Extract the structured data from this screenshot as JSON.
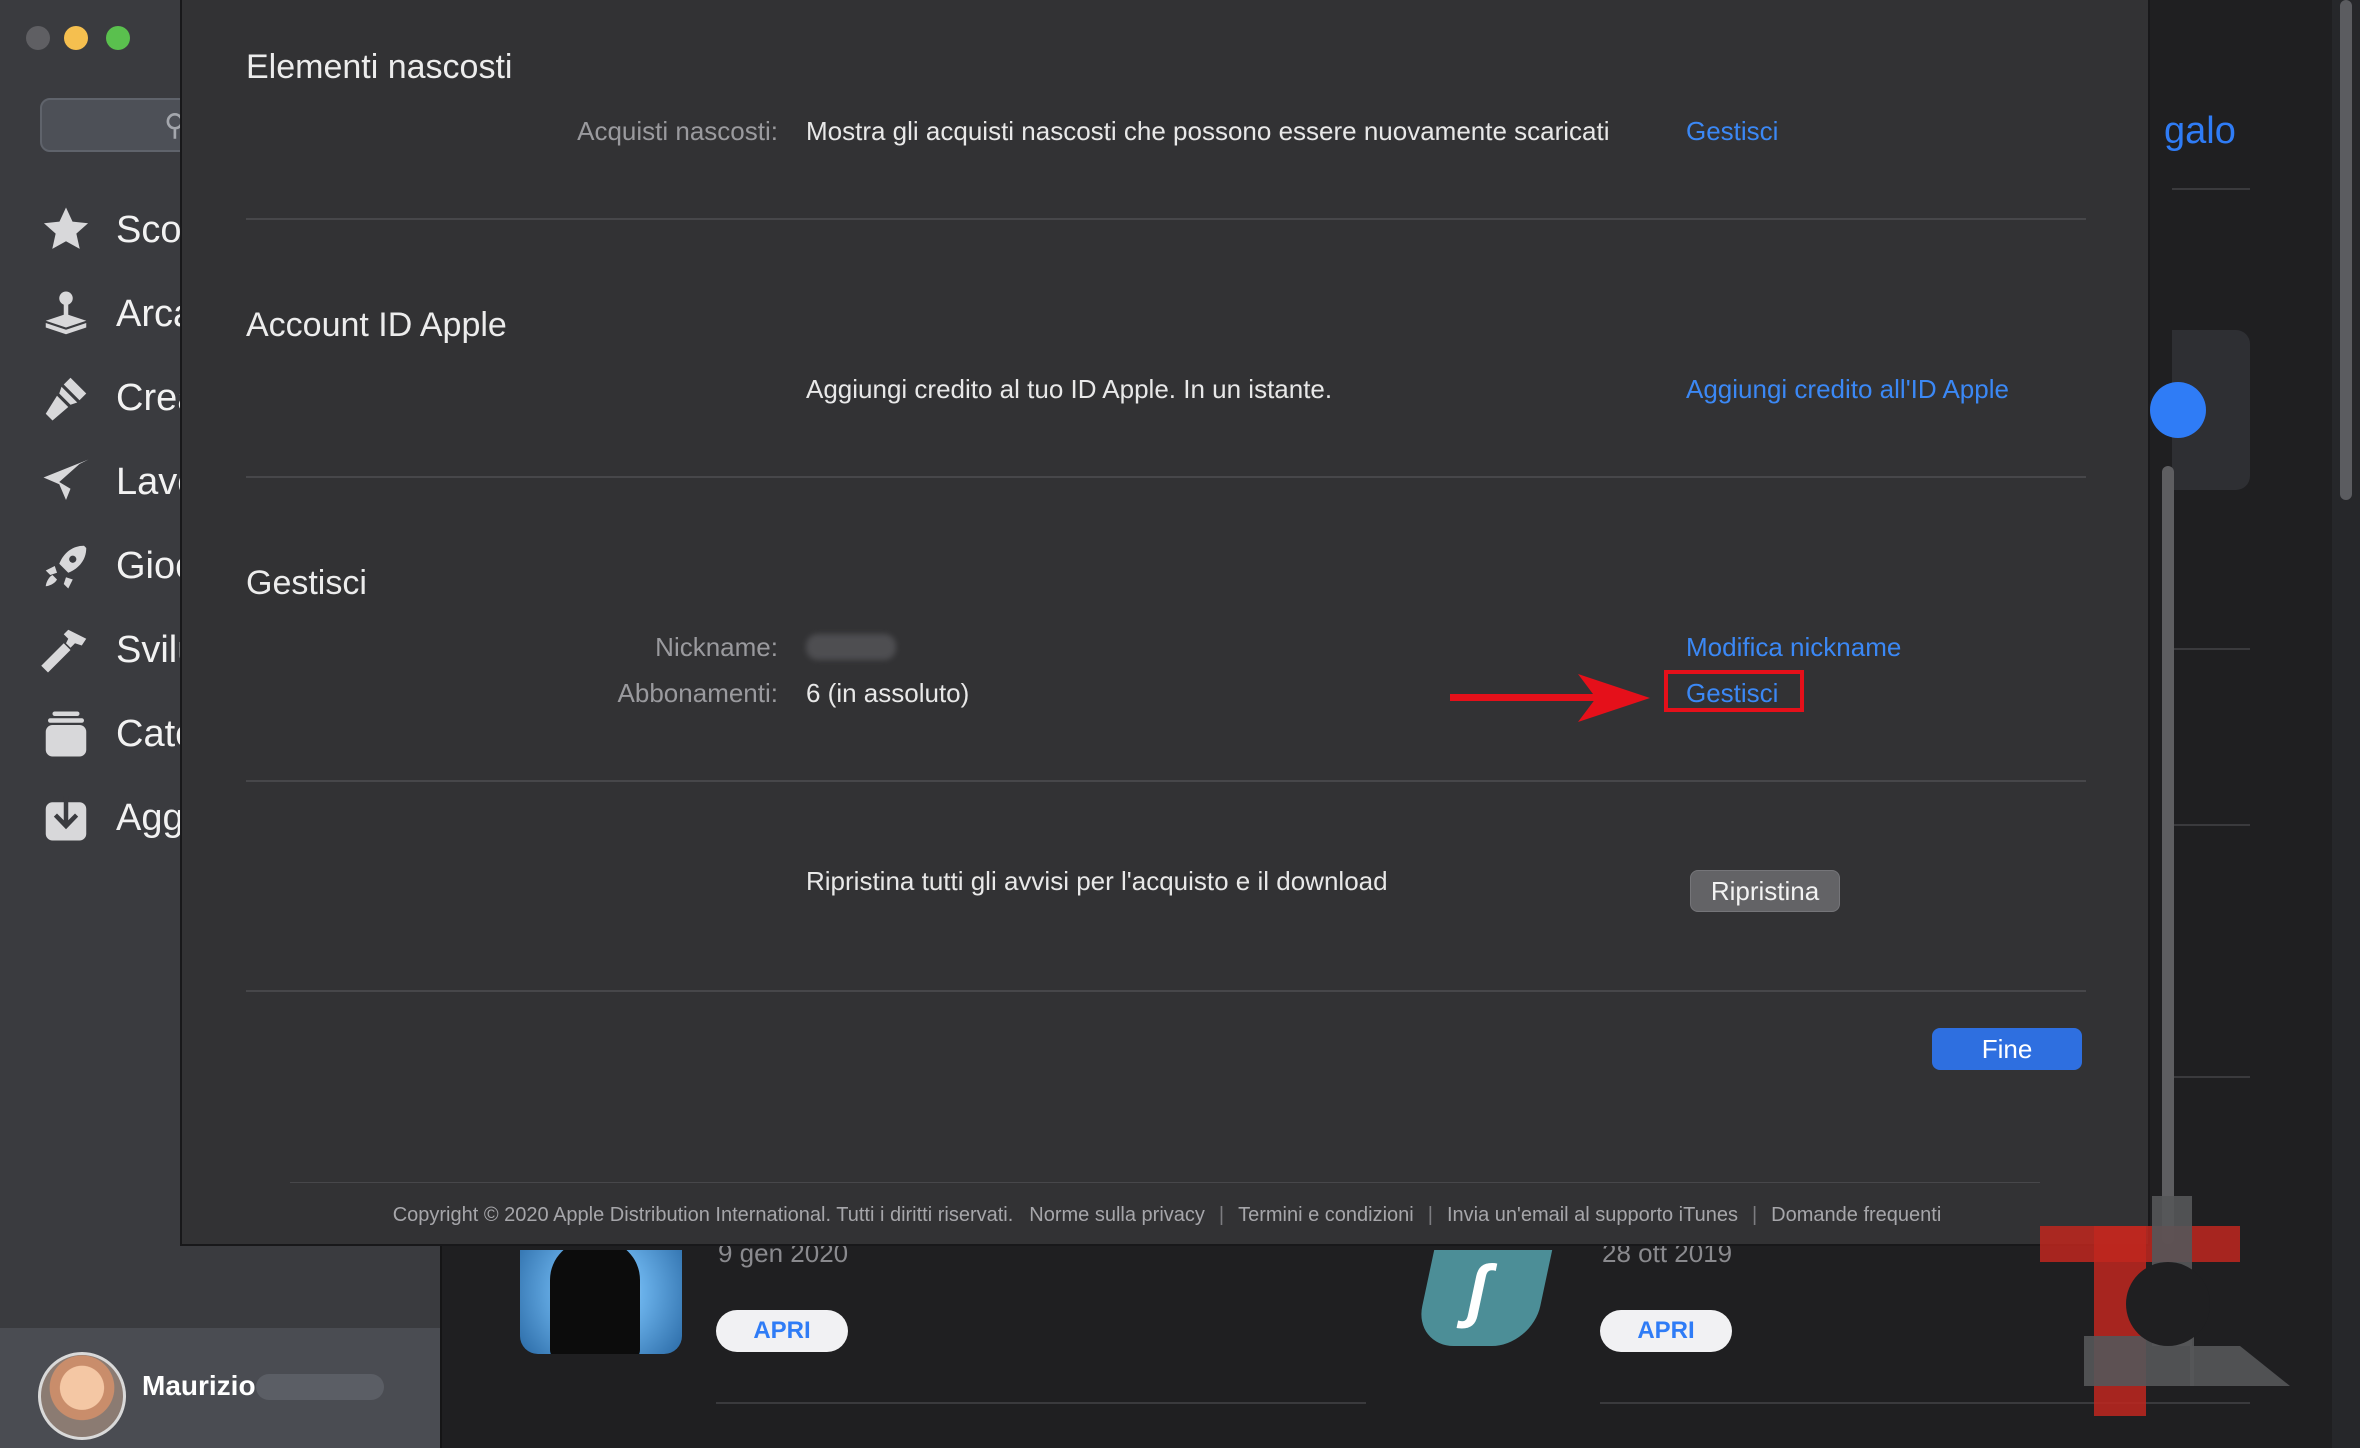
{
  "sidebar": {
    "items": [
      {
        "label": "Sco",
        "icon": "star-icon"
      },
      {
        "label": "Arca",
        "icon": "joystick-icon"
      },
      {
        "label": "Crea",
        "icon": "brush-icon"
      },
      {
        "label": "Lavo",
        "icon": "paper-plane-icon"
      },
      {
        "label": "Gioc",
        "icon": "rocket-icon"
      },
      {
        "label": "Svilu",
        "icon": "hammer-icon"
      },
      {
        "label": "Cate",
        "icon": "layers-icon"
      },
      {
        "label": "Agg",
        "icon": "download-icon"
      }
    ],
    "user_name": "Maurizio"
  },
  "background": {
    "header_link": "galo",
    "apps": [
      {
        "date": "9 gen 2020",
        "button": "APRI"
      },
      {
        "date": "28 ott 2019",
        "button": "APRI"
      }
    ]
  },
  "modal": {
    "hidden_section": {
      "title": "Elementi nascosti",
      "label": "Acquisti nascosti:",
      "value": "Mostra gli acquisti nascosti che possono essere nuovamente scaricati",
      "link": "Gestisci"
    },
    "account_section": {
      "title": "Account ID Apple",
      "value": "Aggiungi credito al tuo ID Apple. In un istante.",
      "link": "Aggiungi credito all'ID Apple"
    },
    "manage_section": {
      "title": "Gestisci",
      "nickname_label": "Nickname:",
      "nickname_link": "Modifica nickname",
      "subs_label": "Abbonamenti:",
      "subs_value": "6 (in assoluto)",
      "subs_link": "Gestisci"
    },
    "reset_section": {
      "value": "Ripristina tutti gli avvisi per l'acquisto e il download",
      "button": "Ripristina"
    },
    "done_button": "Fine",
    "footer": {
      "copyright": "Copyright © 2020 Apple Distribution International. Tutti i diritti riservati.",
      "links": [
        "Norme sulla privacy",
        "Termini e condizioni",
        "Invia un'email al supporto iTunes",
        "Domande frequenti"
      ]
    }
  },
  "colors": {
    "link": "#3b88f5",
    "highlight": "#e5101a",
    "primary_button": "#2e6fe0"
  }
}
